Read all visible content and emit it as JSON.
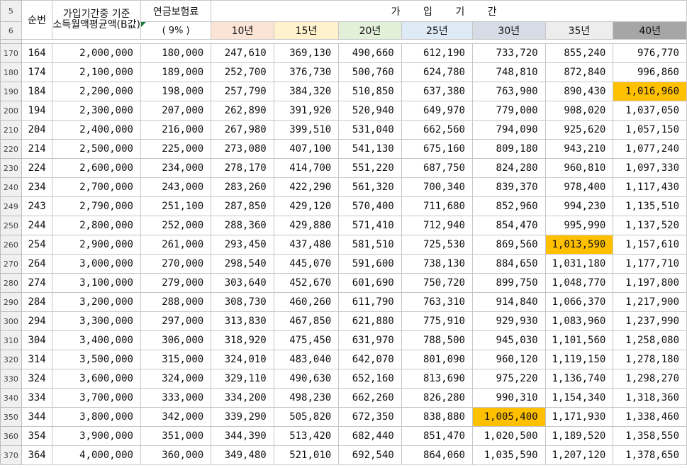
{
  "header": {
    "row_labels": [
      "5",
      "6"
    ],
    "seq_label": "순번",
    "income_label_line1": "가입기간중 기준",
    "income_label_line2": "소득월액평균액(B값)",
    "premium_label": "연금보험료",
    "premium_rate": "( 9% )",
    "period_label": "가 입 기 간",
    "periods": [
      {
        "label": "10년",
        "color": "#fbe4d6"
      },
      {
        "label": "15년",
        "color": "#fff2cc"
      },
      {
        "label": "20년",
        "color": "#e2efd9"
      },
      {
        "label": "25년",
        "color": "#deebf7"
      },
      {
        "label": "30년",
        "color": "#d6dce5"
      },
      {
        "label": "35년",
        "color": "#ededed"
      },
      {
        "label": "40년",
        "color": "#a6a6a6"
      }
    ]
  },
  "hidden_row_label": "15",
  "highlight_color": "#ffc000",
  "rows": [
    {
      "rn": "170",
      "seq": "164",
      "income": "2,000,000",
      "premium": "180,000",
      "y": [
        "247,610",
        "369,130",
        "490,660",
        "612,190",
        "733,720",
        "855,240",
        "976,770"
      ]
    },
    {
      "rn": "180",
      "seq": "174",
      "income": "2,100,000",
      "premium": "189,000",
      "y": [
        "252,700",
        "376,730",
        "500,760",
        "624,780",
        "748,810",
        "872,840",
        "996,860"
      ]
    },
    {
      "rn": "190",
      "seq": "184",
      "income": "2,200,000",
      "premium": "198,000",
      "y": [
        "257,790",
        "384,320",
        "510,850",
        "637,380",
        "763,900",
        "890,430",
        "1,016,960"
      ],
      "hl": [
        6
      ]
    },
    {
      "rn": "200",
      "seq": "194",
      "income": "2,300,000",
      "premium": "207,000",
      "y": [
        "262,890",
        "391,920",
        "520,940",
        "649,970",
        "779,000",
        "908,020",
        "1,037,050"
      ]
    },
    {
      "rn": "210",
      "seq": "204",
      "income": "2,400,000",
      "premium": "216,000",
      "y": [
        "267,980",
        "399,510",
        "531,040",
        "662,560",
        "794,090",
        "925,620",
        "1,057,150"
      ]
    },
    {
      "rn": "220",
      "seq": "214",
      "income": "2,500,000",
      "premium": "225,000",
      "y": [
        "273,080",
        "407,100",
        "541,130",
        "675,160",
        "809,180",
        "943,210",
        "1,077,240"
      ]
    },
    {
      "rn": "230",
      "seq": "224",
      "income": "2,600,000",
      "premium": "234,000",
      "y": [
        "278,170",
        "414,700",
        "551,220",
        "687,750",
        "824,280",
        "960,810",
        "1,097,330"
      ]
    },
    {
      "rn": "240",
      "seq": "234",
      "income": "2,700,000",
      "premium": "243,000",
      "y": [
        "283,260",
        "422,290",
        "561,320",
        "700,340",
        "839,370",
        "978,400",
        "1,117,430"
      ]
    },
    {
      "rn": "249",
      "seq": "243",
      "income": "2,790,000",
      "premium": "251,100",
      "y": [
        "287,850",
        "429,120",
        "570,400",
        "711,680",
        "852,960",
        "994,230",
        "1,135,510"
      ]
    },
    {
      "rn": "250",
      "seq": "244",
      "income": "2,800,000",
      "premium": "252,000",
      "y": [
        "288,360",
        "429,880",
        "571,410",
        "712,940",
        "854,470",
        "995,990",
        "1,137,520"
      ]
    },
    {
      "rn": "260",
      "seq": "254",
      "income": "2,900,000",
      "premium": "261,000",
      "y": [
        "293,450",
        "437,480",
        "581,510",
        "725,530",
        "869,560",
        "1,013,590",
        "1,157,610"
      ],
      "hl": [
        5
      ]
    },
    {
      "rn": "270",
      "seq": "264",
      "income": "3,000,000",
      "premium": "270,000",
      "y": [
        "298,540",
        "445,070",
        "591,600",
        "738,130",
        "884,650",
        "1,031,180",
        "1,177,710"
      ]
    },
    {
      "rn": "280",
      "seq": "274",
      "income": "3,100,000",
      "premium": "279,000",
      "y": [
        "303,640",
        "452,670",
        "601,690",
        "750,720",
        "899,750",
        "1,048,770",
        "1,197,800"
      ]
    },
    {
      "rn": "290",
      "seq": "284",
      "income": "3,200,000",
      "premium": "288,000",
      "y": [
        "308,730",
        "460,260",
        "611,790",
        "763,310",
        "914,840",
        "1,066,370",
        "1,217,900"
      ]
    },
    {
      "rn": "300",
      "seq": "294",
      "income": "3,300,000",
      "premium": "297,000",
      "y": [
        "313,830",
        "467,850",
        "621,880",
        "775,910",
        "929,930",
        "1,083,960",
        "1,237,990"
      ]
    },
    {
      "rn": "310",
      "seq": "304",
      "income": "3,400,000",
      "premium": "306,000",
      "y": [
        "318,920",
        "475,450",
        "631,970",
        "788,500",
        "945,030",
        "1,101,560",
        "1,258,080"
      ]
    },
    {
      "rn": "320",
      "seq": "314",
      "income": "3,500,000",
      "premium": "315,000",
      "y": [
        "324,010",
        "483,040",
        "642,070",
        "801,090",
        "960,120",
        "1,119,150",
        "1,278,180"
      ]
    },
    {
      "rn": "330",
      "seq": "324",
      "income": "3,600,000",
      "premium": "324,000",
      "y": [
        "329,110",
        "490,630",
        "652,160",
        "813,690",
        "975,220",
        "1,136,740",
        "1,298,270"
      ]
    },
    {
      "rn": "340",
      "seq": "334",
      "income": "3,700,000",
      "premium": "333,000",
      "y": [
        "334,200",
        "498,230",
        "662,260",
        "826,280",
        "990,310",
        "1,154,340",
        "1,318,360"
      ]
    },
    {
      "rn": "350",
      "seq": "344",
      "income": "3,800,000",
      "premium": "342,000",
      "y": [
        "339,290",
        "505,820",
        "672,350",
        "838,880",
        "1,005,400",
        "1,171,930",
        "1,338,460"
      ],
      "hl": [
        4
      ]
    },
    {
      "rn": "360",
      "seq": "354",
      "income": "3,900,000",
      "premium": "351,000",
      "y": [
        "344,390",
        "513,420",
        "682,440",
        "851,470",
        "1,020,500",
        "1,189,520",
        "1,358,550"
      ]
    },
    {
      "rn": "370",
      "seq": "364",
      "income": "4,000,000",
      "premium": "360,000",
      "y": [
        "349,480",
        "521,010",
        "692,540",
        "864,060",
        "1,035,590",
        "1,207,120",
        "1,378,650"
      ]
    }
  ]
}
